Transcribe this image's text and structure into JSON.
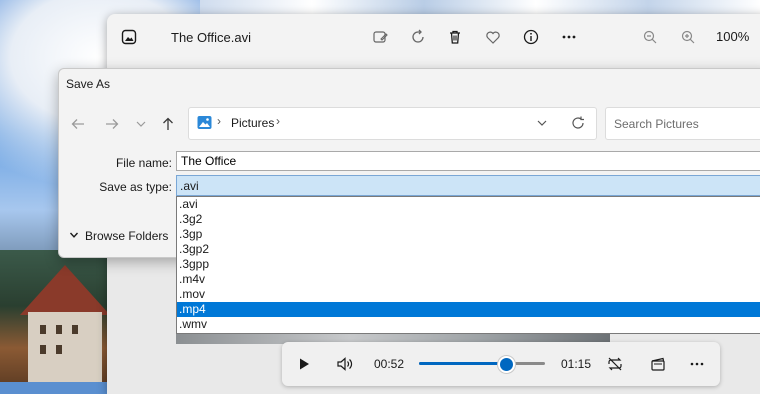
{
  "app": {
    "title": "The Office.avi",
    "zoom": "100%",
    "toolbar_icons": [
      "photos-app-icon",
      "edit-image-icon",
      "rotate-icon",
      "delete-icon",
      "favorite-heart-icon",
      "info-icon",
      "more-icon",
      "zoom-out-icon",
      "zoom-in-icon"
    ]
  },
  "dialog": {
    "title": "Save As",
    "address": {
      "folder_icon": "pictures-folder-icon",
      "path": "Pictures"
    },
    "search": {
      "placeholder": "Search Pictures"
    },
    "file_name_label": "File name:",
    "file_name_value": "The Office",
    "save_as_type_label": "Save as type:",
    "save_as_type_value": ".avi",
    "browse_folders_label": "Browse Folders",
    "type_options": [
      ".avi",
      ".3g2",
      ".3gp",
      ".3gp2",
      ".3gpp",
      ".m4v",
      ".mov",
      ".mp4",
      ".wmv"
    ],
    "highlighted_option": ".mp4"
  },
  "media": {
    "current_time": "00:52",
    "total_time": "01:15",
    "progress": 0.69
  },
  "colors": {
    "accent": "#0067c0",
    "selection": "#0078d7",
    "select_highlight": "#cce4f7"
  }
}
